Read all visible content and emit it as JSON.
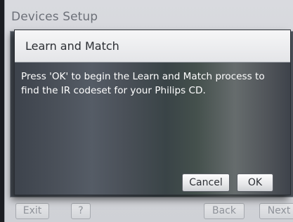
{
  "screen": {
    "title": "Devices Setup"
  },
  "dialog": {
    "title": "Learn and Match",
    "message": "Press 'OK' to begin the Learn and Match process to find the IR codeset for your Philips CD.",
    "cancel_label": "Cancel",
    "ok_label": "OK"
  },
  "footer": {
    "exit_label": "Exit",
    "help_label": "?",
    "back_label": "Back",
    "next_label": "Next"
  },
  "colors": {
    "dialog_text": "#ffffff",
    "header_background": "#eeeff1",
    "frame_background": "#d5d7db"
  }
}
